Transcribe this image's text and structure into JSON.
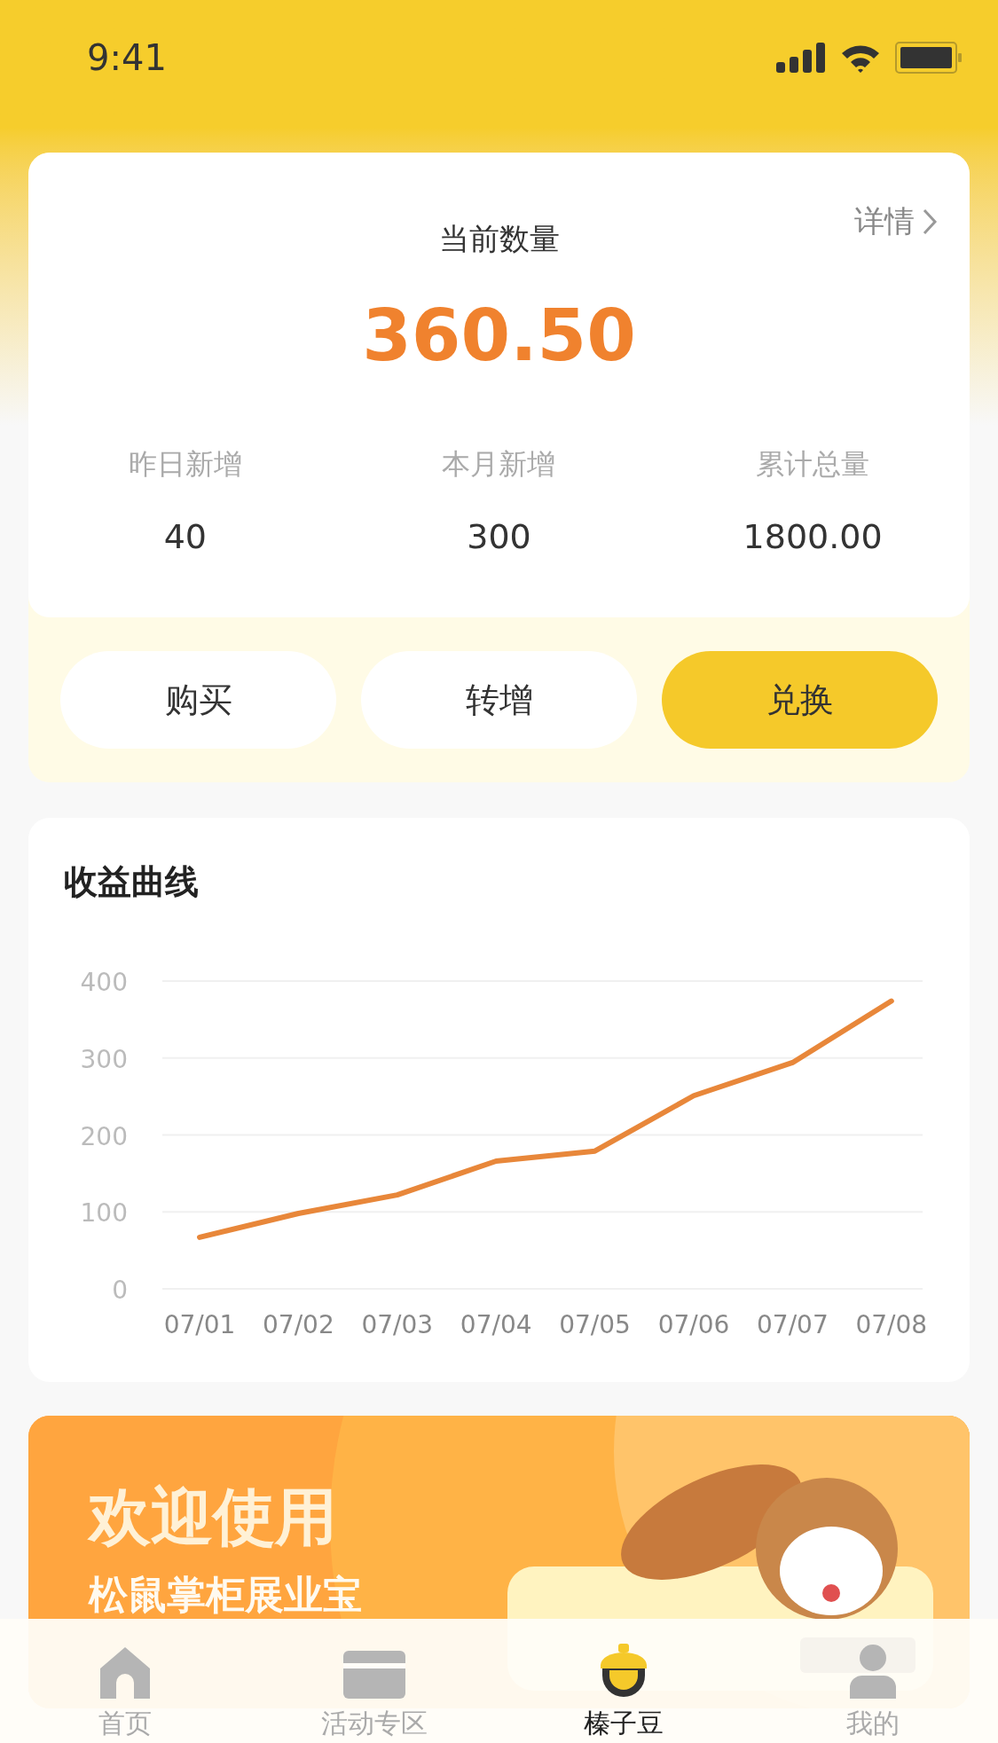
{
  "status_bar": {
    "time": "9:41"
  },
  "summary": {
    "title": "当前数量",
    "detail_link": "详情",
    "amount": "360.50",
    "stats": [
      {
        "label": "昨日新增",
        "value": "40"
      },
      {
        "label": "本月新增",
        "value": "300"
      },
      {
        "label": "累计总量",
        "value": "1800.00"
      }
    ]
  },
  "actions": [
    {
      "label": "购买",
      "selected": false
    },
    {
      "label": "转增",
      "selected": false
    },
    {
      "label": "兑换",
      "selected": true
    }
  ],
  "earnings": {
    "title": "收益曲线",
    "chart_data": {
      "type": "line",
      "categories": [
        "07/01",
        "07/02",
        "07/03",
        "07/04",
        "07/05",
        "07/06",
        "07/07",
        "07/08"
      ],
      "series": [
        {
          "color": "#e8873a",
          "values": [
            67,
            98,
            122,
            166,
            179,
            251,
            294,
            374
          ]
        }
      ],
      "ylim": [
        0,
        400
      ],
      "grid": true,
      "yticks": [
        0,
        100,
        200,
        300,
        400
      ]
    }
  },
  "banner": {
    "title": "欢迎使用",
    "subtitle": "松鼠掌柜展业宝"
  },
  "tab_bar": [
    {
      "label": "首页",
      "kind": "home",
      "selected": false
    },
    {
      "label": "活动专区",
      "kind": "card",
      "selected": false
    },
    {
      "label": "榛子豆",
      "kind": "acorn",
      "selected": true
    },
    {
      "label": "我的",
      "kind": "person",
      "selected": false
    }
  ]
}
